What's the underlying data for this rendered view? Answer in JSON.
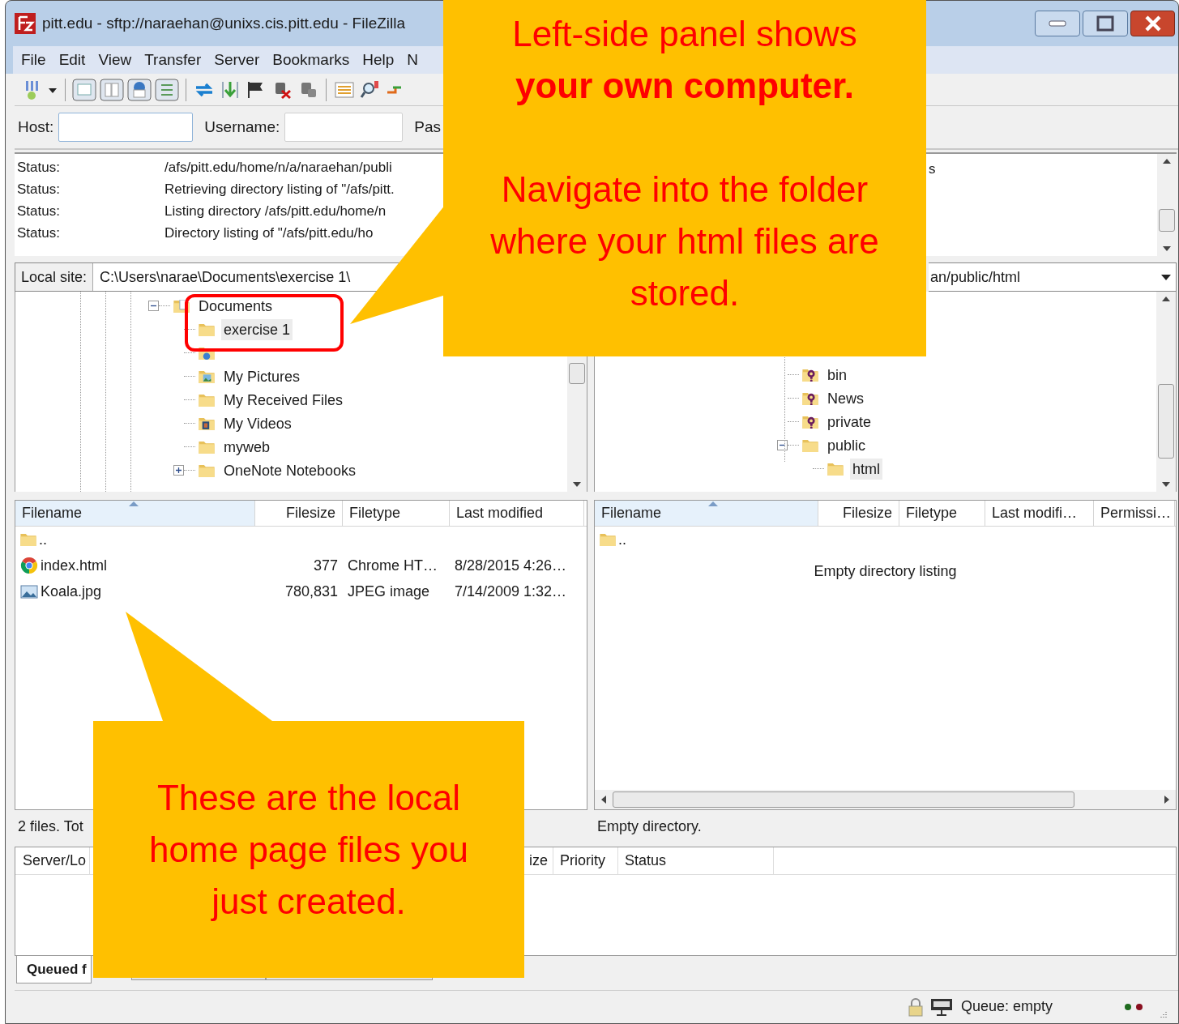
{
  "window": {
    "title": "pitt.edu - sftp://naraehan@unixs.cis.pitt.edu - FileZilla"
  },
  "menu": [
    "File",
    "Edit",
    "View",
    "Transfer",
    "Server",
    "Bookmarks",
    "Help",
    "N"
  ],
  "quickconnect": {
    "host_label": "Host:",
    "username_label": "Username:",
    "password_label": "Pas"
  },
  "message_log": [
    {
      "label": "Status:",
      "message": "/afs/pitt.edu/home/n/a/naraehan/publi"
    },
    {
      "label": "Status:",
      "message": "Retrieving directory listing of \"/afs/pitt."
    },
    {
      "label": "Status:",
      "message": "Listing directory /afs/pitt.edu/home/n"
    },
    {
      "label": "Status:",
      "message": "Directory listing of \"/afs/pitt.edu/ho"
    }
  ],
  "message_log_fragment": "s",
  "local_site": {
    "label": "Local site:",
    "path": "C:\\Users\\narae\\Documents\\exercise 1\\"
  },
  "remote_site": {
    "path": "an/public/html"
  },
  "local_tree": [
    {
      "label": "Documents",
      "kind": "documents",
      "expanded": true,
      "selected": false,
      "children": [
        {
          "label": "exercise 1",
          "kind": "folder",
          "selected": true
        },
        {
          "kind": "music"
        },
        {
          "label": "My Pictures",
          "kind": "pictures",
          "selected": false
        },
        {
          "label": "My Received Files",
          "kind": "folder",
          "selected": false
        },
        {
          "label": "My Videos",
          "kind": "videos",
          "selected": false
        },
        {
          "label": "myweb",
          "kind": "folder",
          "selected": false
        },
        {
          "label": "OneNote Notebooks",
          "kind": "folder",
          "expanded": false,
          "selected": false
        }
      ]
    }
  ],
  "remote_tree": [
    {
      "label": "bin",
      "kind": "unknown",
      "selected": false
    },
    {
      "label": "News",
      "kind": "unknown",
      "selected": false
    },
    {
      "label": "private",
      "kind": "unknown",
      "selected": false
    },
    {
      "label": "public",
      "kind": "folder",
      "expanded": true,
      "selected": false,
      "children": [
        {
          "label": "html",
          "kind": "folder",
          "selected": true
        }
      ]
    }
  ],
  "local_files": {
    "columns": [
      {
        "label": "Filename",
        "sorted": true
      },
      {
        "label": "Filesize",
        "sorted": false
      },
      {
        "label": "Filetype",
        "sorted": false
      },
      {
        "label": "Last modified",
        "sorted": false
      }
    ],
    "rows": [
      {
        "kind": "parent",
        "cells": [
          ".."
        ]
      },
      {
        "kind": "browser",
        "cells": [
          "index.html",
          "377",
          "Chrome HT…",
          "8/28/2015 4:26…"
        ]
      },
      {
        "kind": "image",
        "cells": [
          "Koala.jpg",
          "780,831",
          "JPEG image",
          "7/14/2009 1:32…"
        ]
      }
    ]
  },
  "remote_files": {
    "columns": [
      {
        "label": "Filename",
        "sorted": true
      },
      {
        "label": "Filesize",
        "sorted": false
      },
      {
        "label": "Filetype",
        "sorted": false
      },
      {
        "label": "Last modifi…",
        "sorted": false
      },
      {
        "label": "Permissi…",
        "sorted": false
      }
    ],
    "rows": [
      {
        "kind": "parent",
        "cells": [
          ".."
        ]
      }
    ],
    "empty_message": "Empty directory listing"
  },
  "local_status": "2 files. Tot",
  "remote_status": "Empty directory.",
  "queue": {
    "columns": [
      "Server/Lo",
      "ize",
      "Priority",
      "Status"
    ]
  },
  "queue_tabs": [
    {
      "label": "Queued f",
      "selected": true
    }
  ],
  "status_bar": {
    "queue": "Queue: empty"
  },
  "callouts": [
    {
      "paragraphs": [
        "Left-side panel shows **your own computer.**",
        "Navigate into the folder where your html files are stored."
      ]
    },
    {
      "paragraphs": [
        "These are the local home page files you just created."
      ]
    }
  ]
}
